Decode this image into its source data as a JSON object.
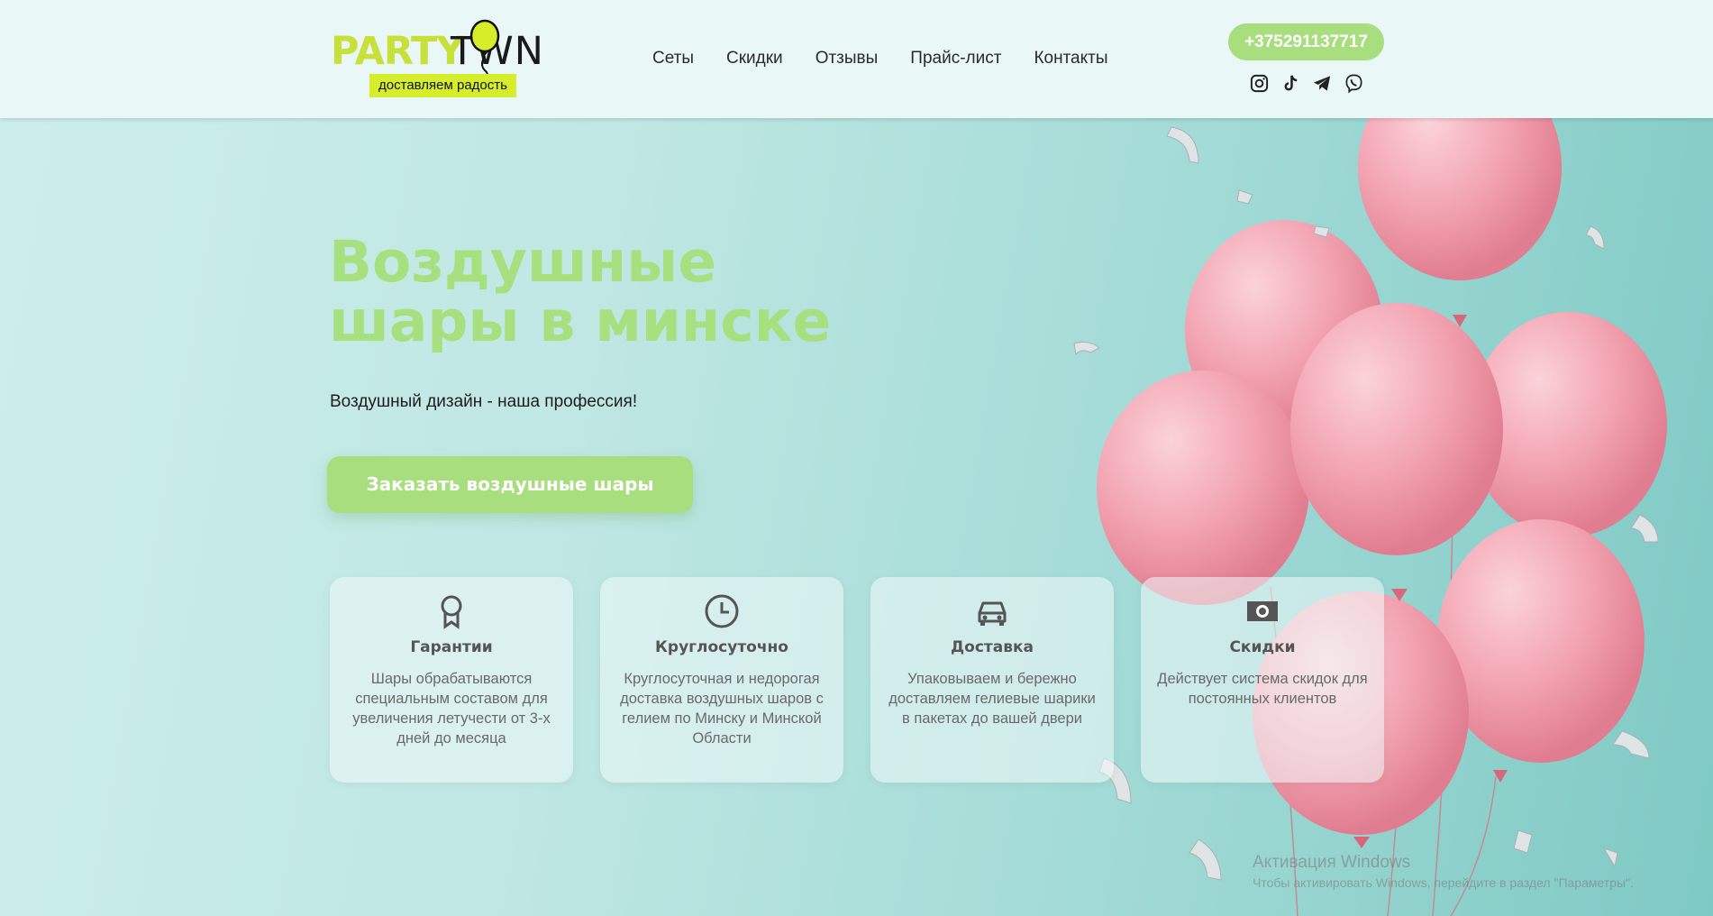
{
  "header": {
    "logo": {
      "part1": "PARTY",
      "part2": "TWN",
      "tagline": "доставляем радость"
    },
    "nav": [
      {
        "label": "Сеты"
      },
      {
        "label": "Скидки"
      },
      {
        "label": "Отзывы"
      },
      {
        "label": "Прайс-лист"
      },
      {
        "label": "Контакты"
      }
    ],
    "phone": "+375291137717",
    "socials": [
      "instagram-icon",
      "tiktok-icon",
      "telegram-icon",
      "viber-icon"
    ]
  },
  "hero": {
    "title_line1": "Воздушные",
    "title_line2": "шары в минске",
    "subtitle": "Воздушный дизайн - наша профессия!",
    "cta": "Заказать воздушные шары"
  },
  "features": [
    {
      "icon": "award-icon",
      "title": "Гарантии",
      "text": "Шары обрабатываются специальным составом для увеличения летучести от 3-х дней до месяца"
    },
    {
      "icon": "clock-icon",
      "title": "Круглосуточно",
      "text": "Круглосуточная и недорогая доставка воздушных шаров с гелием по Минску и Минской Области"
    },
    {
      "icon": "car-icon",
      "title": "Доставка",
      "text": "Упаковываем и бережно доставляем гелиевые шарики в пакетах до вашей двери"
    },
    {
      "icon": "money-icon",
      "title": "Скидки",
      "text": "Действует система скидок для постоянных клиентов"
    }
  ],
  "watermark": {
    "line1": "Активация Windows",
    "line2": "Чтобы активировать Windows, перейдите в раздел \"Параметры\"."
  },
  "colors": {
    "accent": "#a8de7e",
    "logo_yellow": "#d6ee2a",
    "balloon": "#f2a6b3"
  }
}
